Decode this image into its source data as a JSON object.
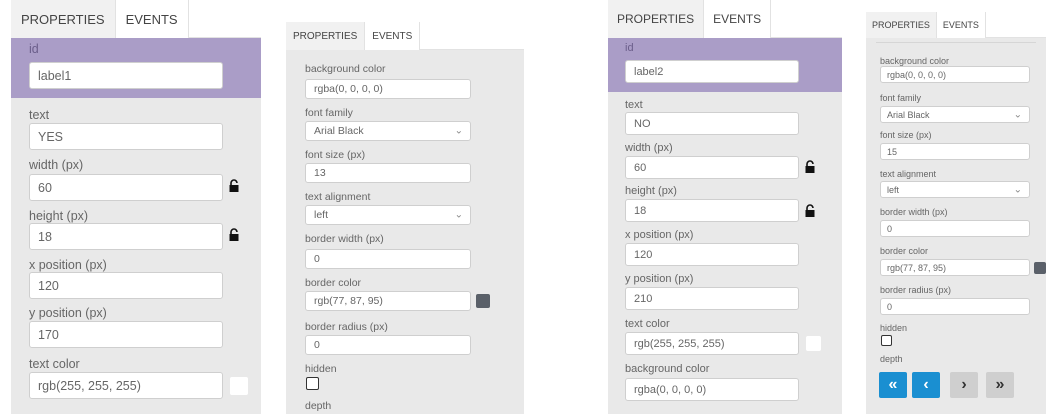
{
  "colors": {
    "purple_highlight": "#aa9dc7",
    "panel_bg": "#e9e9e9",
    "button_blue": "#1a8fd1",
    "swatch_gray": "#5a6069",
    "swatch_white": "#ffffff"
  },
  "panelA": {
    "tabs": [
      "PROPERTIES",
      "EVENTS"
    ],
    "id_label": "id",
    "id_value": "label1",
    "text_label": "text",
    "text_value": "YES",
    "width_label": "width (px)",
    "width_value": "60",
    "height_label": "height (px)",
    "height_value": "18",
    "x_label": "x position (px)",
    "x_value": "120",
    "y_label": "y position (px)",
    "y_value": "170",
    "textcolor_label": "text color",
    "textcolor_value": "rgb(255, 255, 255)"
  },
  "panelB": {
    "tabs": [
      "PROPERTIES",
      "EVENTS"
    ],
    "bgcolor_label": "background color",
    "bgcolor_value": "rgba(0, 0, 0, 0)",
    "fontfamily_label": "font family",
    "fontfamily_value": "Arial Black",
    "fontsize_label": "font size (px)",
    "fontsize_value": "13",
    "align_label": "text alignment",
    "align_value": "left",
    "borderwidth_label": "border width (px)",
    "borderwidth_value": "0",
    "bordercolor_label": "border color",
    "bordercolor_value": "rgb(77, 87, 95)",
    "borderradius_label": "border radius (px)",
    "borderradius_value": "0",
    "hidden_label": "hidden",
    "depth_label": "depth"
  },
  "panelC": {
    "tabs": [
      "PROPERTIES",
      "EVENTS"
    ],
    "id_label": "id",
    "id_value": "label2",
    "text_label": "text",
    "text_value": "NO",
    "width_label": "width (px)",
    "width_value": "60",
    "height_label": "height (px)",
    "height_value": "18",
    "x_label": "x position (px)",
    "x_value": "120",
    "y_label": "y position (px)",
    "y_value": "210",
    "textcolor_label": "text color",
    "textcolor_value": "rgb(255, 255, 255)",
    "bgcolor_label": "background color",
    "bgcolor_value": "rgba(0, 0, 0, 0)"
  },
  "panelD": {
    "tabs": [
      "PROPERTIES",
      "EVENTS"
    ],
    "bgcolor_label": "background color",
    "bgcolor_value": "rgba(0, 0, 0, 0)",
    "fontfamily_label": "font family",
    "fontfamily_value": "Arial Black",
    "fontsize_label": "font size (px)",
    "fontsize_value": "15",
    "align_label": "text alignment",
    "align_value": "left",
    "borderwidth_label": "border width (px)",
    "borderwidth_value": "0",
    "bordercolor_label": "border color",
    "bordercolor_value": "rgb(77, 87, 95)",
    "borderradius_label": "border radius (px)",
    "borderradius_value": "0",
    "hidden_label": "hidden",
    "depth_label": "depth",
    "buttons": [
      "«",
      "‹",
      "›",
      "»"
    ]
  }
}
